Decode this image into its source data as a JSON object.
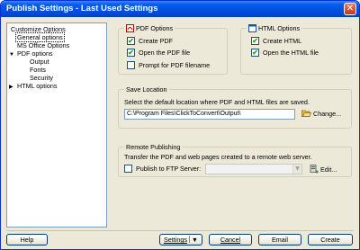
{
  "window": {
    "title": "Publish Settings - Last Used Settings"
  },
  "sidebar": {
    "items": [
      {
        "label": "Customize Options",
        "expander": ""
      },
      {
        "label": "General options",
        "expander": ""
      },
      {
        "label": "MS Office Options",
        "expander": ""
      },
      {
        "label": "PDF options",
        "expander": "▼"
      },
      {
        "label": "Output",
        "expander": ""
      },
      {
        "label": "Fonts",
        "expander": ""
      },
      {
        "label": "Security",
        "expander": ""
      },
      {
        "label": "HTML options",
        "expander": "▶"
      }
    ]
  },
  "pdf_options": {
    "title": "PDF Options",
    "create_pdf": {
      "label": "Create PDF",
      "checked": true
    },
    "open_pdf": {
      "label": "Open the PDF file",
      "checked": true
    },
    "prompt_filename": {
      "label": "Prompt for PDF filename",
      "checked": false
    }
  },
  "html_options": {
    "title": "HTML Options",
    "create_html": {
      "label": "Create HTML",
      "checked": true
    },
    "open_html": {
      "label": "Open the HTML file",
      "checked": true
    }
  },
  "save_location": {
    "title": "Save Location",
    "description": "Select the default location where PDF and HTML files are saved.",
    "path": "C:\\Program Files\\ClickToConvert\\Output\\",
    "change_label": "Change..."
  },
  "remote_publishing": {
    "title": "Remote Publishing",
    "description": "Transfer the PDF and web pages created to a remote web server.",
    "ftp_label": "Publish to FTP Server:",
    "ftp_checked": false,
    "ftp_selected": "",
    "edit_label": "Edit..."
  },
  "footer": {
    "help_label": "Help",
    "settings_label": "Settings",
    "settings_arrow": "▼",
    "cancel_label": "Cancel",
    "email_label": "Email",
    "create_label": "Create"
  }
}
